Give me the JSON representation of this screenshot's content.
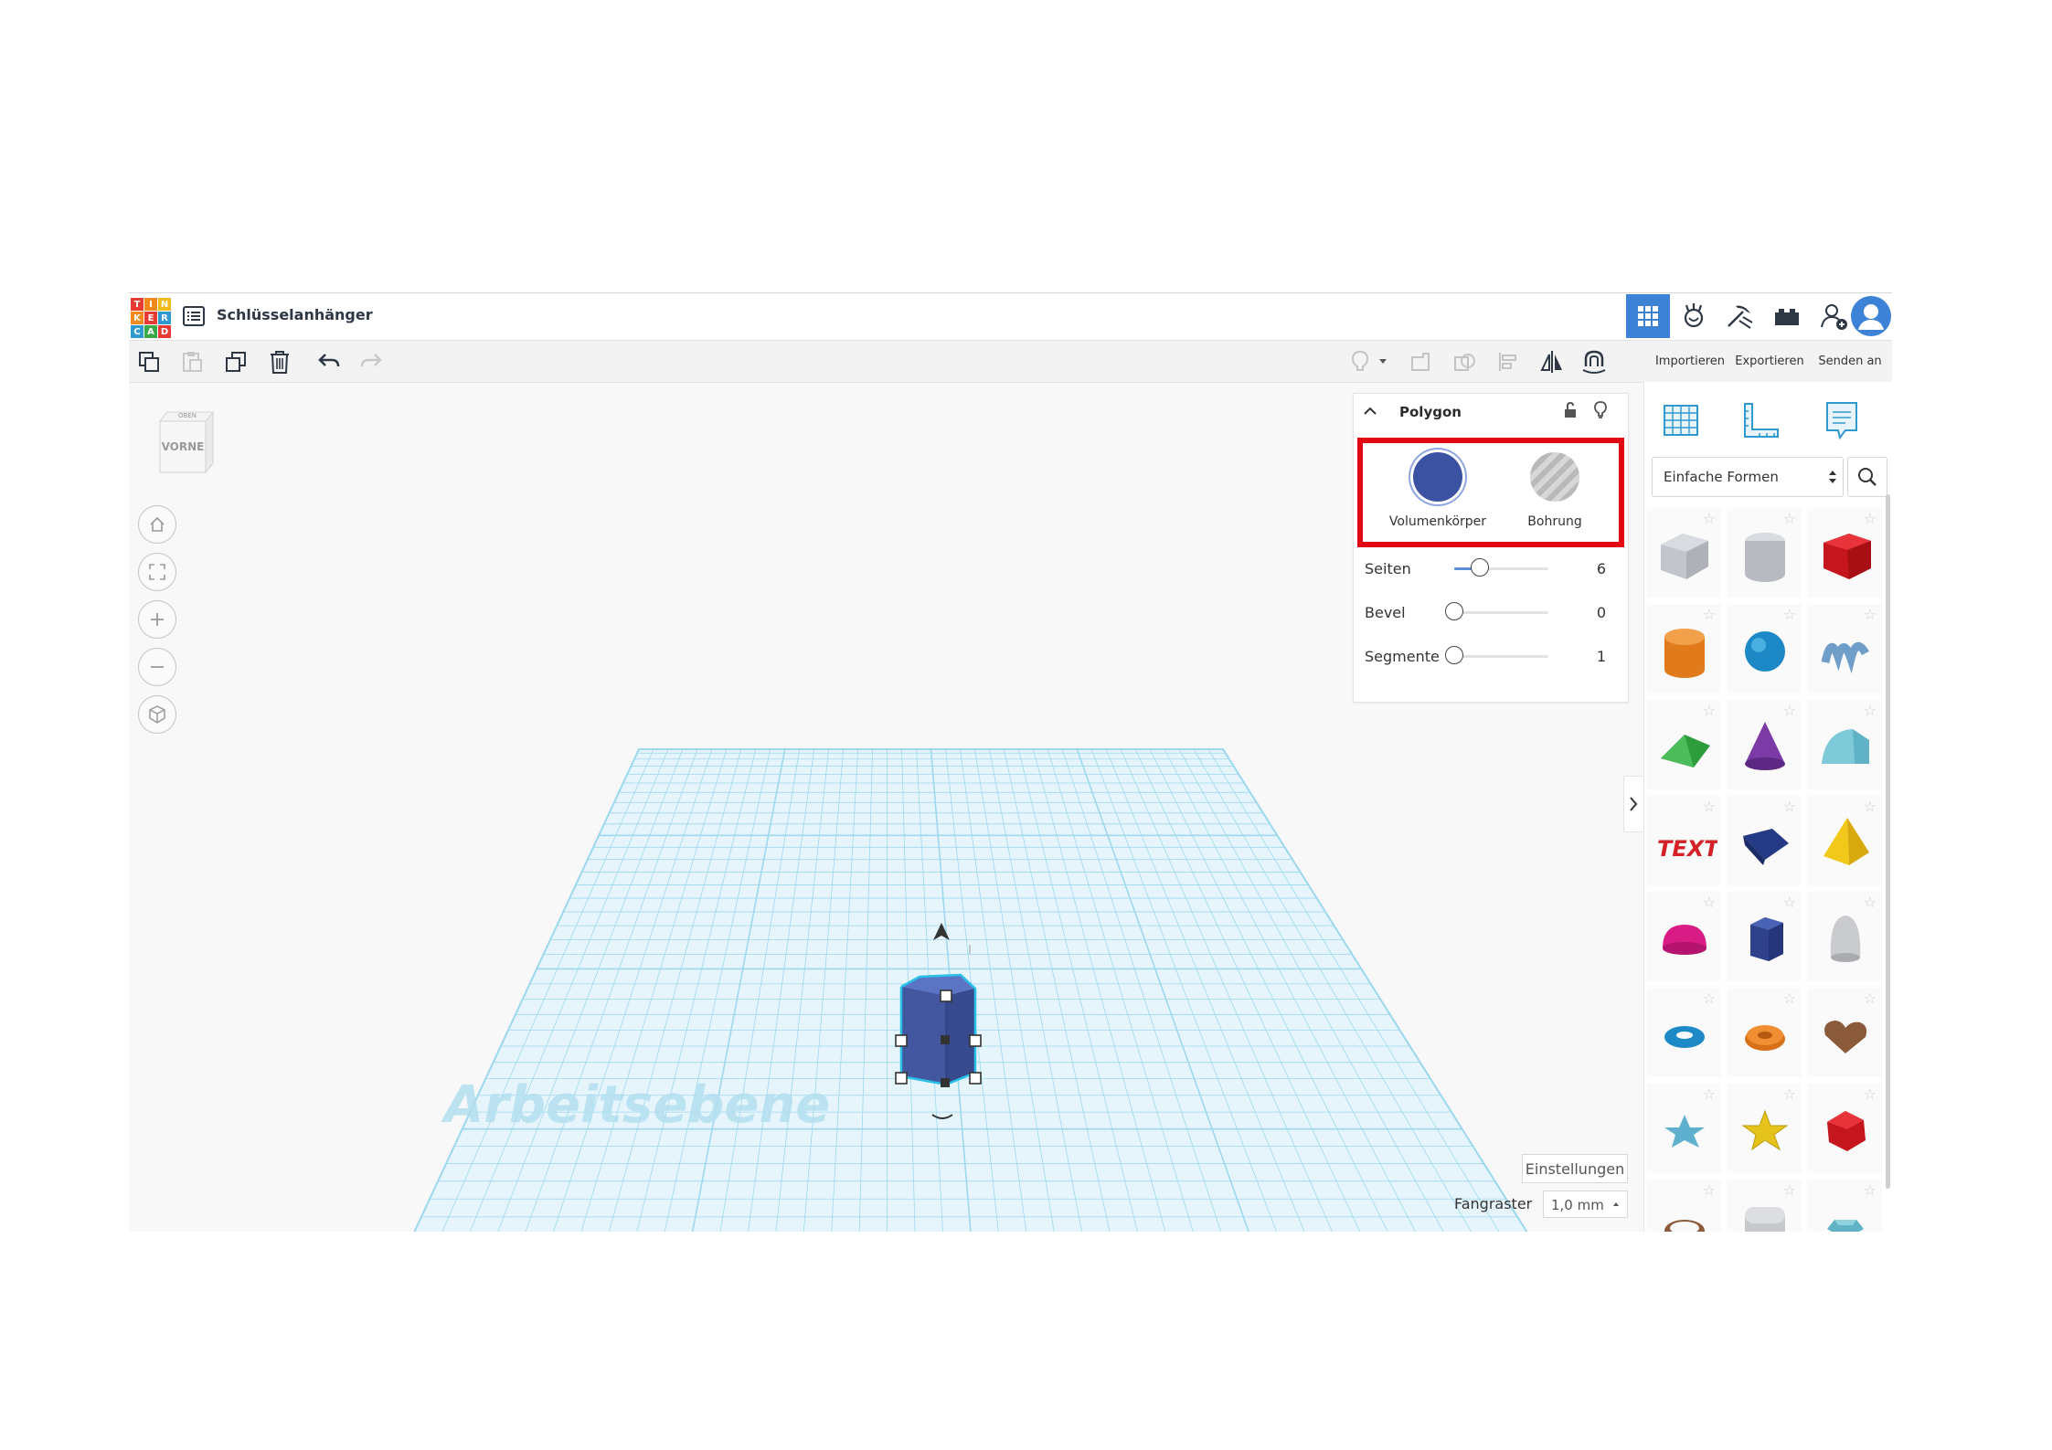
{
  "app": {
    "logo_letters": [
      "T",
      "I",
      "N",
      "K",
      "E",
      "R",
      "C",
      "A",
      "D"
    ],
    "logo_colors": [
      "#e73a34",
      "#f08a1c",
      "#f0b91c",
      "#f08a1c",
      "#e73a34",
      "#2e9ad0",
      "#2e9ad0",
      "#38a947",
      "#e73a34"
    ],
    "document_title": "Schlüsselanhänger"
  },
  "top_nav": {
    "items": [
      "3d-design-icon",
      "sim-lab-icon",
      "pickaxe-icon",
      "lego-bricks-icon",
      "add-user-icon",
      "avatar"
    ],
    "active_color": "#3c82d6"
  },
  "toolbar": {
    "import_label": "Importieren",
    "export_label": "Exportieren",
    "send_label": "Senden an"
  },
  "viewcube": {
    "top_label": "OBEN",
    "front_label": "VORNE"
  },
  "workplane": {
    "label": "Arbeitsebene",
    "grid_color": "#9dd8ef"
  },
  "inspector": {
    "title": "Polygon",
    "solid_label": "Volumenkörper",
    "hole_label": "Bohrung",
    "solid_color": "#3b52a3",
    "highlight_color": "#e30613",
    "properties": [
      {
        "label": "Seiten",
        "value": "6",
        "fraction": 0.27
      },
      {
        "label": "Bevel",
        "value": "0",
        "fraction": 0.0
      },
      {
        "label": "Segmente",
        "value": "1",
        "fraction": 0.0
      }
    ]
  },
  "shapes_panel": {
    "category": "Einfache Formen",
    "shapes": [
      "box-hole",
      "cylinder-hole",
      "box",
      "cylinder",
      "sphere",
      "scribble",
      "roof",
      "cone",
      "round-roof",
      "text",
      "wedge",
      "pyramid",
      "half-sphere",
      "polygon",
      "paraboloid",
      "torus",
      "tube",
      "heart",
      "star",
      "star-yellow",
      "icosahedron",
      "ring",
      "cube-rounded",
      "gem"
    ]
  },
  "bottom": {
    "settings_label": "Einstellungen",
    "snap_label": "Fangraster",
    "snap_value": "1,0 mm"
  }
}
